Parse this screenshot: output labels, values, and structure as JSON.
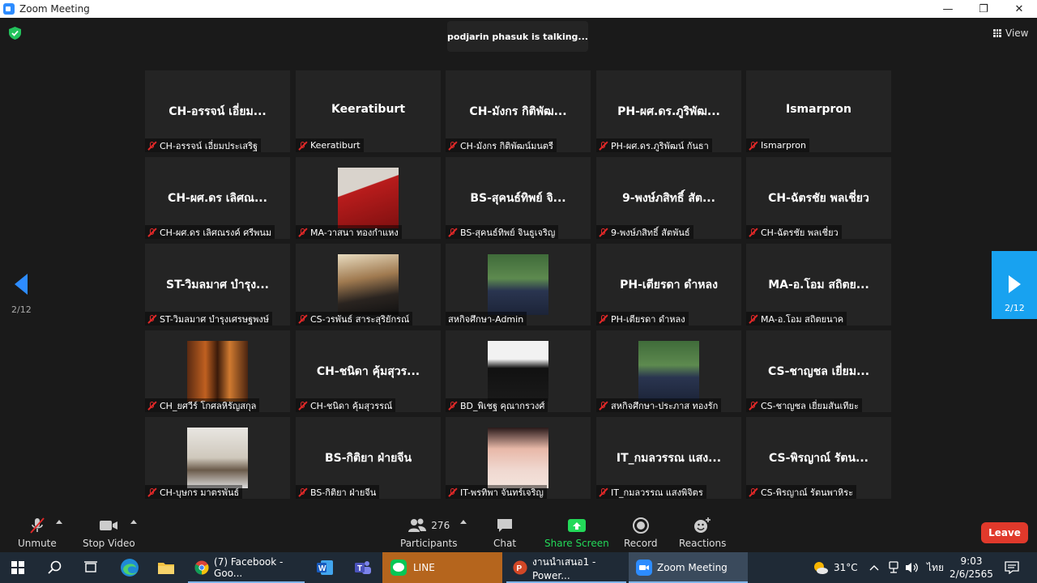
{
  "window": {
    "title": "Zoom Meeting",
    "minimize": "—",
    "maximize": "❐",
    "close": "✕"
  },
  "top": {
    "talking": "podjarin phasuk is talking...",
    "view_label": "View"
  },
  "paging": {
    "left_page": "2/12",
    "right_page": "2/12"
  },
  "tiles": [
    {
      "big": "CH-อรรจน์ เอี่ยม...",
      "name": "CH-อรรจน์ เอี่ยมประเสริฐ",
      "muted": true
    },
    {
      "big": "Keeratiburt",
      "name": "Keeratiburt",
      "muted": true
    },
    {
      "big": "CH-มังกร กิติพัฒ...",
      "name": "CH-มังกร กิติพัฒน์มนตรี",
      "muted": true
    },
    {
      "big": "PH-ผศ.ดร.ภูริพัฒ...",
      "name": "PH-ผศ.ดร.ภูริพัฒน์ กันธา",
      "muted": true
    },
    {
      "big": "Ismarpron",
      "name": "Ismarpron",
      "muted": true
    },
    {
      "big": "CH-ผศ.ดร เลิศณ...",
      "name": "CH-ผศ.ดร เลิศณรงค์ ศรีพนม",
      "muted": true
    },
    {
      "big": "",
      "name": "MA-วาสนา ทองกำแหง",
      "muted": true,
      "video": "red"
    },
    {
      "big": "BS-สุคนธ์ทิพย์ จิ...",
      "name": "BS-สุคนธ์ทิพย์ จินธูเจริญ",
      "muted": true
    },
    {
      "big": "9-พงษ์ภสิทธิ์ สัต...",
      "name": "9-พงษ์ภสิทธิ์  สัตพันธ์",
      "muted": true
    },
    {
      "big": "CH-ฉัตรชัย พลเชี่ยว",
      "name": "CH-ฉัตรชัย พลเชี่ยว",
      "muted": true
    },
    {
      "big": "ST-วิมลมาศ บำรุง...",
      "name": "ST-วิมลมาศ บำรุงเศรษฐพงษ์",
      "muted": true
    },
    {
      "big": "",
      "name": "CS-วรพันธ์ สาระสุริยักรณ์",
      "muted": true,
      "video": "dark"
    },
    {
      "big": "",
      "name": "สหกิจศึกษา-Admin",
      "muted": false,
      "video": "green"
    },
    {
      "big": "PH-เตียรดา ดำหลง",
      "name": "PH-เตียรดา ดำหลง",
      "muted": true
    },
    {
      "big": "MA-อ.โอม สถิตย...",
      "name": "MA-อ.โอม สถิตยนาค",
      "muted": true
    },
    {
      "big": "",
      "name": "CH_ยศวีร์ โกศลหิรัญสกุล",
      "muted": true,
      "video": "orange"
    },
    {
      "big": "CH-ชนิดา คุ้มสุวร...",
      "name": "CH-ชนิดา คุ้มสุวรรณ์",
      "muted": true
    },
    {
      "big": "",
      "name": "BD_พิเชฐ  คุณากรวงศ์",
      "muted": true,
      "video": "white"
    },
    {
      "big": "",
      "name": "สหกิจศึกษา-ประภาส ทองรัก",
      "muted": true,
      "video": "green"
    },
    {
      "big": "CS-ชาญชล เยี่ยม...",
      "name": "CS-ชาญชล เยี่ยมสันเทียะ",
      "muted": true
    },
    {
      "big": "",
      "name": "CH-บุษกร มาตรพันธ์",
      "muted": true,
      "video": "gray"
    },
    {
      "big": "BS-กิติยา ฝ่ายจีน",
      "name": "BS-กิติยา ฝ่ายจีน",
      "muted": true
    },
    {
      "big": "",
      "name": "IT-พรทิพา จันทร์เจริญ",
      "muted": true,
      "video": "pink"
    },
    {
      "big": "IT_กมลวรรณ แสง...",
      "name": "IT_กมลวรรณ แสงพิจิตร",
      "muted": true
    },
    {
      "big": "CS-พิรญาณ์ รัตน...",
      "name": "CS-พิรญาณ์ รัตนพาหิระ",
      "muted": true
    }
  ],
  "toolbar": {
    "unmute": "Unmute",
    "stop_video": "Stop Video",
    "participants_count": "276",
    "participants": "Participants",
    "chat": "Chat",
    "share_screen": "Share Screen",
    "record": "Record",
    "reactions": "Reactions",
    "leave": "Leave"
  },
  "taskbar": {
    "facebook": "(7) Facebook - Goo...",
    "line": "LINE",
    "powerpoint": "งานนำเสนอ1 - Power...",
    "zoom": "Zoom Meeting",
    "temp": "31°C",
    "lang": "ไทย",
    "time": "9:03",
    "date": "2/6/2565"
  },
  "colors": {
    "accent": "#2d8cff",
    "share_green": "#23d959",
    "leave_red": "#e0392b",
    "mute_red": "#e02828"
  }
}
